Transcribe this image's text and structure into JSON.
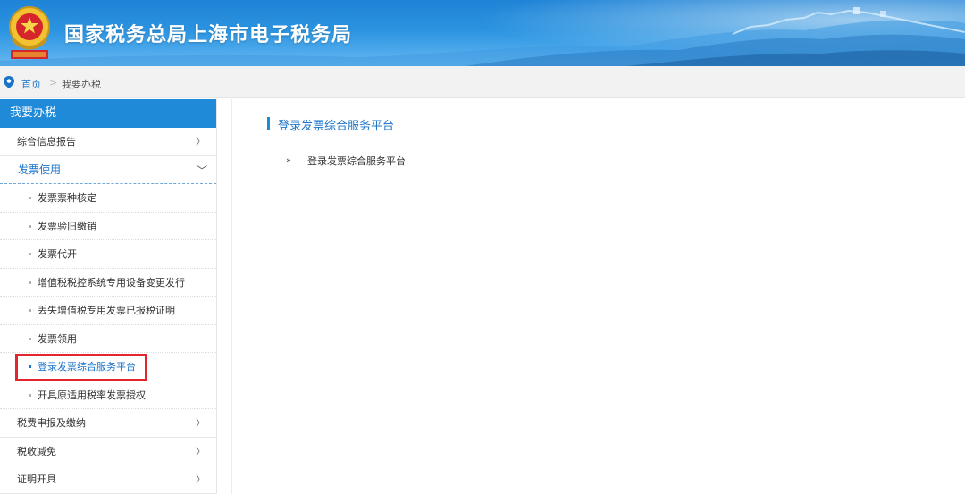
{
  "header": {
    "title": "国家税务总局上海市电子税务局",
    "emblem_icon": "tax-emblem-icon",
    "background_color": "#2a93e0"
  },
  "breadcrumb": {
    "icon": "location-pin-icon",
    "home": "首页",
    "separator": ">",
    "current": "我要办税"
  },
  "sidebar": {
    "heading": "我要办税",
    "items": [
      {
        "label": "综合信息报告",
        "arrow": "〉",
        "expanded": false
      },
      {
        "label": "发票使用",
        "arrow": "﹀",
        "expanded": true,
        "children": [
          {
            "label": "发票票种核定",
            "active": false
          },
          {
            "label": "发票验旧缴销",
            "active": false
          },
          {
            "label": "发票代开",
            "active": false
          },
          {
            "label": "增值税税控系统专用设备变更发行",
            "active": false
          },
          {
            "label": "丢失增值税专用发票已报税证明",
            "active": false
          },
          {
            "label": "发票领用",
            "active": false
          },
          {
            "label": "登录发票综合服务平台",
            "active": true
          },
          {
            "label": "开具原适用税率发票授权",
            "active": false
          }
        ]
      },
      {
        "label": "税费申报及缴纳",
        "arrow": "〉",
        "expanded": false
      },
      {
        "label": "税收减免",
        "arrow": "〉",
        "expanded": false
      },
      {
        "label": "证明开具",
        "arrow": "〉",
        "expanded": false
      }
    ],
    "accent_color": "#1e8ad8",
    "highlight_color": "#e3262d"
  },
  "content": {
    "section_title": "登录发票综合服务平台",
    "link_arrow": "»",
    "link_label": "登录发票综合服务平台"
  }
}
